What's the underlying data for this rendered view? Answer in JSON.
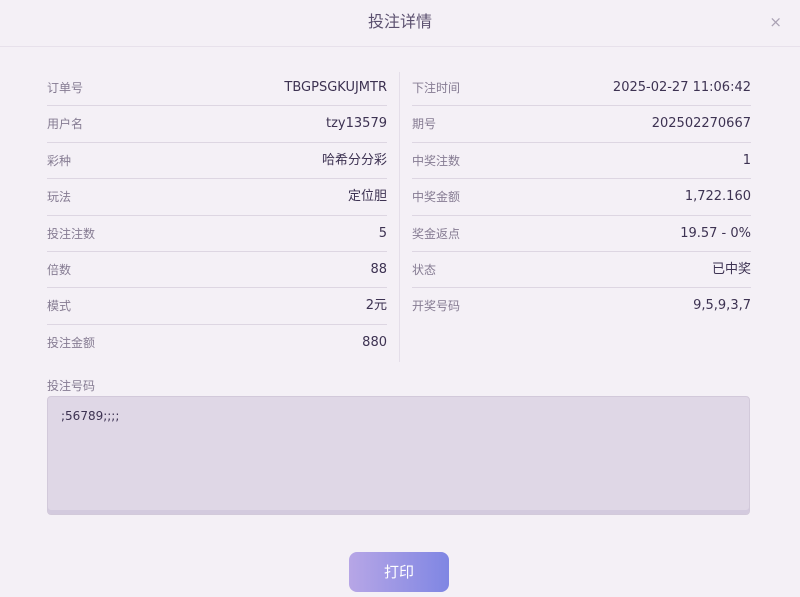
{
  "dialog": {
    "title": "投注详情",
    "close_icon": "×"
  },
  "left_rows": [
    {
      "label": "订单号",
      "value": "TBGPSGKUJMTR"
    },
    {
      "label": "用户名",
      "value": "tzy13579"
    },
    {
      "label": "彩种",
      "value": "哈希分分彩"
    },
    {
      "label": "玩法",
      "value": "定位胆"
    },
    {
      "label": "投注注数",
      "value": "5"
    },
    {
      "label": "倍数",
      "value": "88"
    },
    {
      "label": "模式",
      "value": "2元"
    },
    {
      "label": "投注金额",
      "value": "880"
    }
  ],
  "right_rows": [
    {
      "label": "下注时间",
      "value": "2025-02-27 11:06:42"
    },
    {
      "label": "期号",
      "value": "202502270667"
    },
    {
      "label": "中奖注数",
      "value": "1"
    },
    {
      "label": "中奖金额",
      "value": "1,722.160"
    },
    {
      "label": "奖金返点",
      "value": "19.57 - 0%"
    },
    {
      "label": "状态",
      "value": "已中奖"
    },
    {
      "label": "开奖号码",
      "value": "9,5,9,3,7"
    }
  ],
  "bet_numbers": {
    "label": "投注号码",
    "value": ";56789;;;;"
  },
  "actions": {
    "print_label": "打印"
  }
}
